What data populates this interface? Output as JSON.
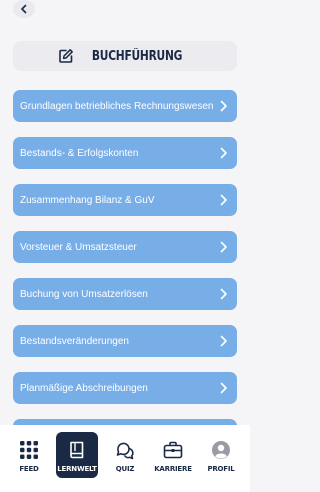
{
  "header": {
    "back_icon": "chevron-left-icon",
    "title": "BUCHFÜHRUNG",
    "title_icon": "edit-icon"
  },
  "topics": [
    {
      "label": "Grundlagen betriebliches Rechnungswesen"
    },
    {
      "label": "Bestands- & Erfolgskonten"
    },
    {
      "label": "Zusammenhang Bilanz & GuV"
    },
    {
      "label": "Vorsteuer & Umsatzsteuer"
    },
    {
      "label": "Buchung von Umsatzerlösen"
    },
    {
      "label": "Bestandsveränderungen"
    },
    {
      "label": "Planmäßige Abschreibungen"
    },
    {
      "label": ""
    }
  ],
  "nav": {
    "active": "LERNWELT",
    "items": [
      {
        "label": "FEED",
        "icon": "grid-icon"
      },
      {
        "label": "LERNWELT",
        "icon": "book-icon"
      },
      {
        "label": "QUIZ",
        "icon": "chat-bubbles-icon"
      },
      {
        "label": "KARRIERE",
        "icon": "briefcase-icon"
      },
      {
        "label": "PROFIL",
        "icon": "user-icon"
      }
    ]
  },
  "colors": {
    "background": "#f5f5f7",
    "item_blue": "#78aee8",
    "navy": "#1b2a44",
    "title_card": "#ebebf0"
  }
}
